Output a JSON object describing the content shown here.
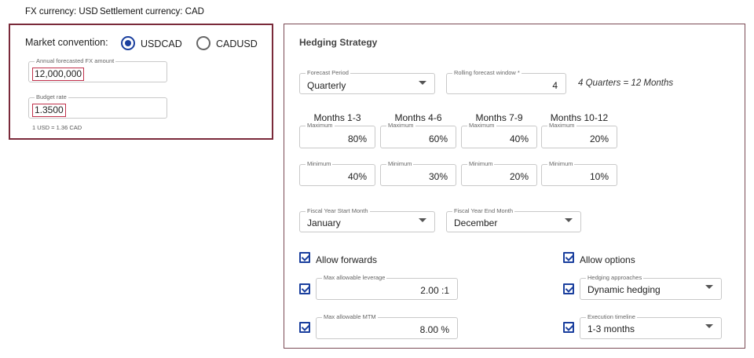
{
  "header": {
    "fx_currency": "FX currency: USD",
    "settlement_currency": "Settlement currency: CAD"
  },
  "left_panel": {
    "market_convention_label": "Market convention:",
    "options": [
      {
        "label": "USDCAD",
        "selected": true
      },
      {
        "label": "CADUSD",
        "selected": false
      }
    ],
    "annual_amount": {
      "label": "Annual forecasted FX amount",
      "value": "12,000,000"
    },
    "budget_rate": {
      "label": "Budget rate",
      "value": "1.3500"
    },
    "rate_note": "1 USD = 1.36 CAD"
  },
  "right_panel": {
    "title": "Hedging Strategy",
    "forecast_period": {
      "label": "Forecast Period",
      "value": "Quarterly"
    },
    "rolling_window": {
      "label": "Rolling forecast window *",
      "value": "4"
    },
    "window_note": "4 Quarters = 12 Months",
    "columns": [
      {
        "header": "Months 1-3",
        "max_label": "Maximum",
        "max": "80%",
        "min_label": "Minimum",
        "min": "40%"
      },
      {
        "header": "Months 4-6",
        "max_label": "Maximum",
        "max": "60%",
        "min_label": "Minimum",
        "min": "30%"
      },
      {
        "header": "Months 7-9",
        "max_label": "Maximum",
        "max": "40%",
        "min_label": "Minimum",
        "min": "20%"
      },
      {
        "header": "Months 10-12",
        "max_label": "Maximum",
        "max": "20%",
        "min_label": "Minimum",
        "min": "10%"
      }
    ],
    "fiscal_start": {
      "label": "Fiscal Year Start Month",
      "value": "January"
    },
    "fiscal_end": {
      "label": "Fiscal Year End Month",
      "value": "December"
    },
    "allow_forwards": {
      "label": "Allow forwards",
      "checked": true
    },
    "allow_options": {
      "label": "Allow options",
      "checked": true
    },
    "max_leverage": {
      "label": "Max allowable leverage",
      "value": "2.00 :1",
      "checked": true
    },
    "max_mtm": {
      "label": "Max allowable MTM",
      "value": "8.00 %",
      "checked": true
    },
    "hedging_approaches": {
      "label": "Hedging approaches",
      "value": "Dynamic hedging",
      "checked": true
    },
    "execution_timeline": {
      "label": "Execution timeline",
      "value": "1-3 months",
      "checked": true
    }
  },
  "colors": {
    "accent": "#1a3f9e",
    "panel_border": "#7a2a3a",
    "highlight": "#c0304a"
  }
}
